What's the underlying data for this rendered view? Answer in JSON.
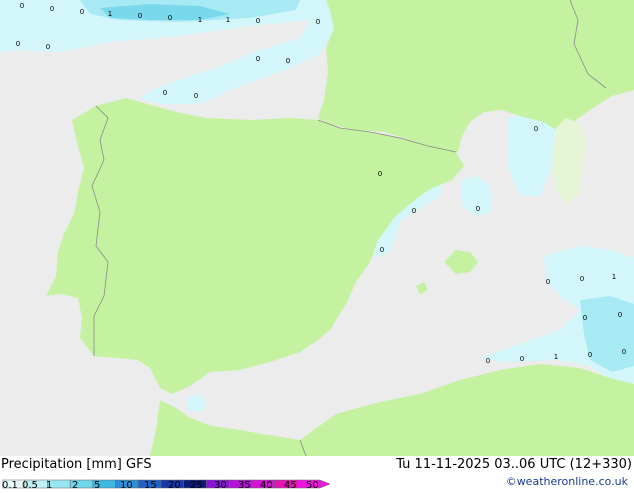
{
  "footer": {
    "title": "Precipitation [mm]  GFS",
    "datetime": "Tu 11-11-2025 03..06 UTC (12+330)",
    "credit": "©weatheronline.co.uk"
  },
  "legend": {
    "ticks": [
      "0.1",
      "0.5",
      "1",
      "2",
      "5",
      "10",
      "15",
      "20",
      "25",
      "30",
      "35",
      "40",
      "45",
      "50"
    ],
    "colors": [
      "#e8fafa",
      "#bff0f5",
      "#9ae6f0",
      "#6fd6ea",
      "#3fb7e3",
      "#2b8fd6",
      "#1f63c7",
      "#1838a8",
      "#0d1a7a",
      "#8a14d6",
      "#b414d6",
      "#d614d6",
      "#e614b4",
      "#f014e0"
    ]
  },
  "map": {
    "colors": {
      "sea": "#ececec",
      "land": "#c5f2a0",
      "precip_light": "#d2f6fa",
      "precip_medium": "#a8eaf4",
      "precip_strong": "#7ad8ec",
      "border": "#8a8a8a"
    },
    "point_labels": [
      "0",
      "0",
      "0",
      "1",
      "0",
      "0",
      "1",
      "1",
      "0",
      "0",
      "0",
      "0",
      "0",
      "0",
      "0",
      "0",
      "0",
      "0",
      "0",
      "0",
      "0",
      "0",
      "0",
      "1",
      "0",
      "0",
      "0",
      "0",
      "1",
      "0",
      "0"
    ]
  }
}
